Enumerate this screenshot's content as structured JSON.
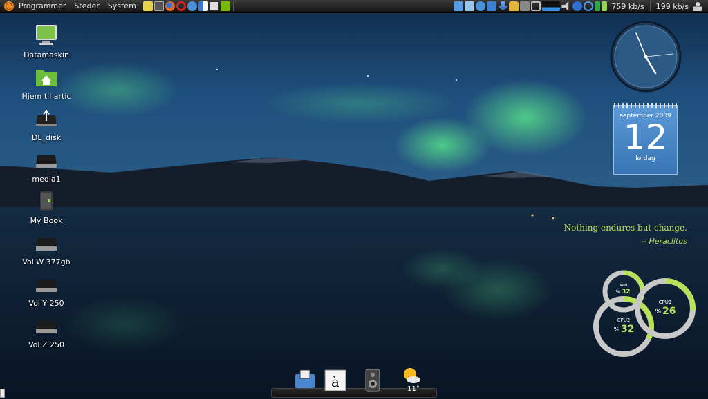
{
  "panel": {
    "menus": [
      "Programmer",
      "Steder",
      "System"
    ],
    "net_down": "759 kb/s",
    "net_up": "199 kb/s"
  },
  "desktop_icons": [
    {
      "label": "Datamaskin",
      "icon": "computer-icon"
    },
    {
      "label": "Hjem til artic",
      "icon": "home-folder-icon"
    },
    {
      "label": "DL_disk",
      "icon": "usb-drive-icon"
    },
    {
      "label": "media1",
      "icon": "hard-drive-icon"
    },
    {
      "label": "My Book",
      "icon": "external-drive-icon"
    },
    {
      "label": "Vol W 377gb",
      "icon": "hard-drive-icon"
    },
    {
      "label": "Vol Y 250",
      "icon": "hard-drive-icon"
    },
    {
      "label": "Vol Z 250",
      "icon": "hard-drive-icon"
    }
  ],
  "calendar": {
    "month": "september 2009",
    "day": "12",
    "weekday": "lørdag"
  },
  "quote": {
    "text": "Nothing endures but change.",
    "author": "-- Heraclitus"
  },
  "gauges": {
    "ram": {
      "label": "RAM",
      "value": "32",
      "fraction": 0.32
    },
    "cpu1": {
      "label": "CPU1",
      "value": "26",
      "fraction": 0.26
    },
    "cpu2": {
      "label": "CPU2",
      "value": "32",
      "fraction": 0.32
    },
    "percent": "%"
  },
  "dock": {
    "temperature": "11°"
  },
  "colors": {
    "accent": "#b8e05a",
    "gauge_ring": "#c8c8c8"
  }
}
